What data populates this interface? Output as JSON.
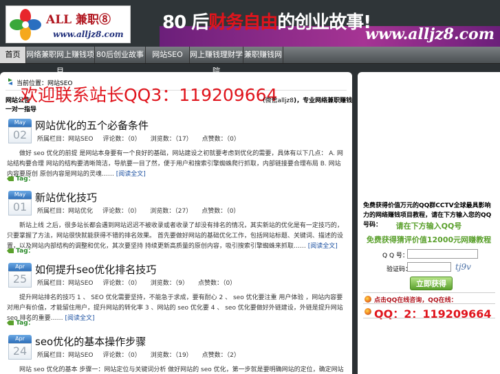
{
  "header": {
    "logo_name": "ALL 兼职⑧",
    "logo_url": "www.alljz8.com",
    "slogan_pre": "80 后",
    "slogan_hl": "财务自由",
    "slogan_post": "的创业故事!",
    "band_url": "www.alljz8.com"
  },
  "nav": {
    "items": [
      {
        "label": "首页"
      },
      {
        "label": "网络兼职网上赚钱项目"
      },
      {
        "label": "80后创业故事"
      },
      {
        "label": "网站SEO"
      },
      {
        "label": "网上赚钱理财学院"
      },
      {
        "label": "兼职赚钱网"
      }
    ]
  },
  "main": {
    "breadcrumb": "当前位置：网站SEO",
    "notice": {
      "pre": "网站公告",
      "big": "欢迎联系站长QQ3：119209664",
      "post_pre": "(微信",
      "post_id": "alljz8",
      "post_after": ")，专业网络兼职赚钱创业导师",
      "line2": "一对一指导"
    },
    "posts": [
      {
        "month": "May",
        "day": "02",
        "title": "网站优化的五个必备条件",
        "category": "所属栏目：网站SEO",
        "comments": "评论数：（0）",
        "views": "浏览数：（17）",
        "likes": "点赞数：（0）",
        "excerpt": "做好 seo 优化的前提 是网站本身要有一个良好的基础，网站建设之初就要考虑到优化的需要，具体有以下几点： A. 网站结构要合理 网站的结构要清晰简洁，导航要一目了然，便于用户和搜索引擎蜘蛛爬行抓取，内部链接要合理布局 B. 网站内容要原创 原创内容是网站的灵魂……",
        "more": "[阅读全文]",
        "tag": "Tag："
      },
      {
        "month": "May",
        "day": "01",
        "title": "新站优化技巧",
        "category": "所属栏目：网站优化",
        "comments": "评论数：（0）",
        "views": "浏览数：（27）",
        "likes": "点赞数：（0）",
        "excerpt": "新站上线 之后，很多站长都会遇到网站迟迟不被收录或者收录了却没有排名的情况，其实新站的优化是有一定技巧的，只要掌握了方法，网站很快就能获得不错的排名效果。 首先要做好网站的基础优化工作，包括网站标题、关键词、描述的设置，以及网站内部结构的调整和优化，其次要坚持 持续更新高质量的原创内容，吸引搜索引擎蜘蛛来抓取……",
        "more": "[阅读全文]",
        "tag": "Tag："
      },
      {
        "month": "Apr",
        "day": "25",
        "title": "如何提升seo优化排名技巧",
        "category": "所属栏目：网站SEO",
        "comments": "评论数：（0）",
        "views": "浏览数：（9）",
        "likes": "点赞数：（0）",
        "excerpt": "提升网站排名的技巧 1 、 SEO 优化需要坚持，不能急于求成，要有耐心 2 、 seo 优化要注重 用户体验 ，网站内容要对用户有价值，才能留住用户，提升网站的转化率 3 、网站的 seo 优化要 4 、 seo 优化要做好外链建设，外链是提升网站 seo 排名的重要……",
        "more": "[阅读全文]",
        "tag": "Tag："
      },
      {
        "month": "Apr",
        "day": "24",
        "title": "seo优化的基本操作步骤",
        "category": "所属栏目：网站SEO",
        "comments": "评论数：（0）",
        "views": "浏览数：（19）",
        "likes": "点赞数：（2）",
        "excerpt": "网站 seo 优化的基本 步骤一：网站定位与关键词分析 做好网站的 seo 优化，第一步就是要明确网站的定位，确定网站的核心关键词和长尾关键词，第二步是网站结构优化，包括 robots.txt User-",
        "more": "",
        "tag": ""
      }
    ]
  },
  "sidebar": {
    "text": "免费获得价值万元的QQ群CCTV全球最具影响力的网络赚钱项目教程，请在下方输入您的QQ号码：",
    "hint1": "请在下方输入QQ号",
    "hint2": "免费获得猜评价值12000元网赚教程",
    "qq_label": "Q Q 号：",
    "qq_placeholder": "",
    "code_label": "验证码：",
    "code_placeholder": "",
    "captcha": "tj9v",
    "submit": "立即获得",
    "link": "点击QQ在线咨询，QQ在线：",
    "qq_big": "QQ：2：119209664"
  },
  "colors": {
    "accent_red": "#e0141c",
    "band_purple": "#a63494",
    "green": "#5aa02c"
  }
}
